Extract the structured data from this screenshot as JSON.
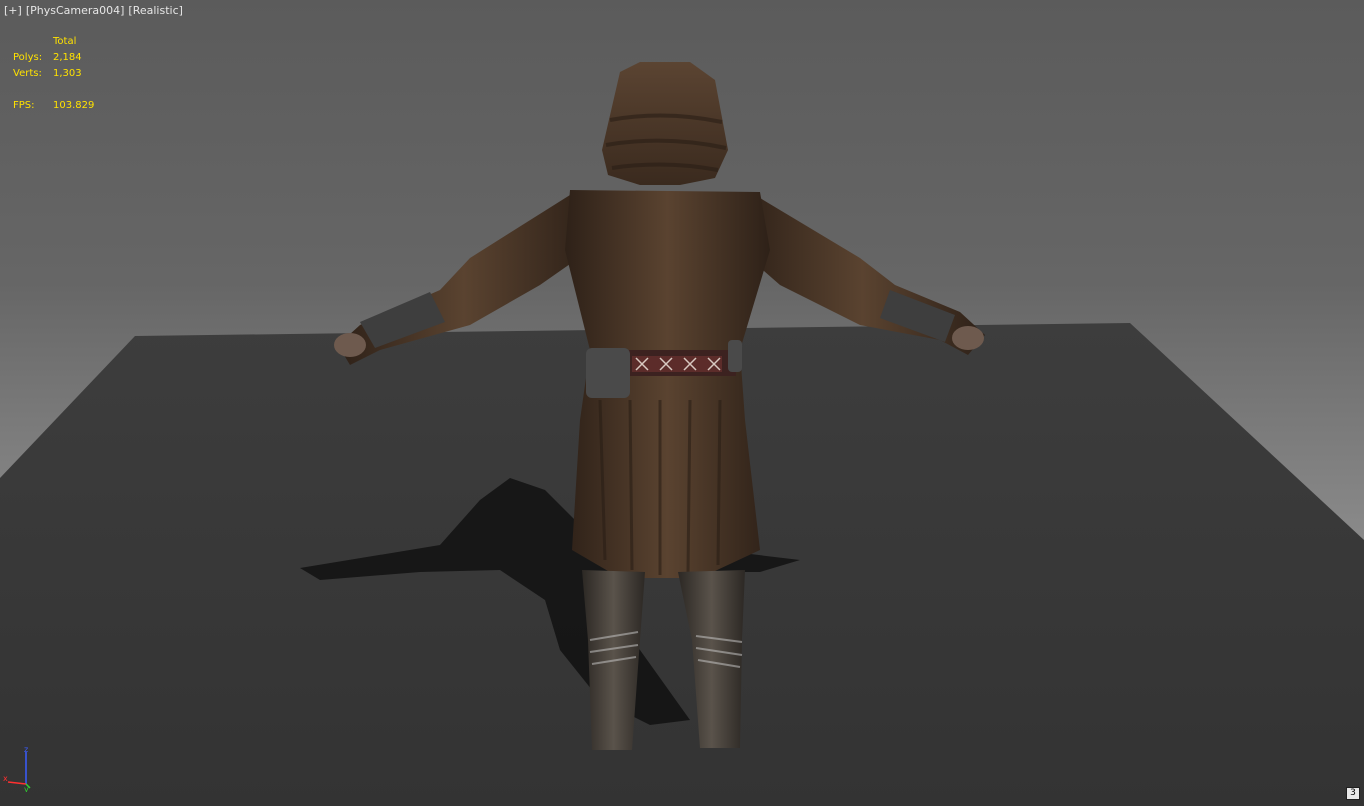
{
  "viewport": {
    "label_plus": "[+]",
    "label_camera": "[PhysCamera004]",
    "label_shading": "[Realistic]",
    "view_number": "3"
  },
  "stats": {
    "header": "Total",
    "polys_label": "Polys:",
    "polys_value": "2,184",
    "verts_label": "Verts:",
    "verts_value": "1,303",
    "fps_label": "FPS:",
    "fps_value": "103.829"
  },
  "gizmo": {
    "z_label": "z",
    "y_label": "y",
    "x_label": "x"
  },
  "colors": {
    "stats_text": "#ffe200",
    "label_text": "#e6e6e6",
    "ground": "#3a3a3a",
    "robe": "#4a3526"
  }
}
